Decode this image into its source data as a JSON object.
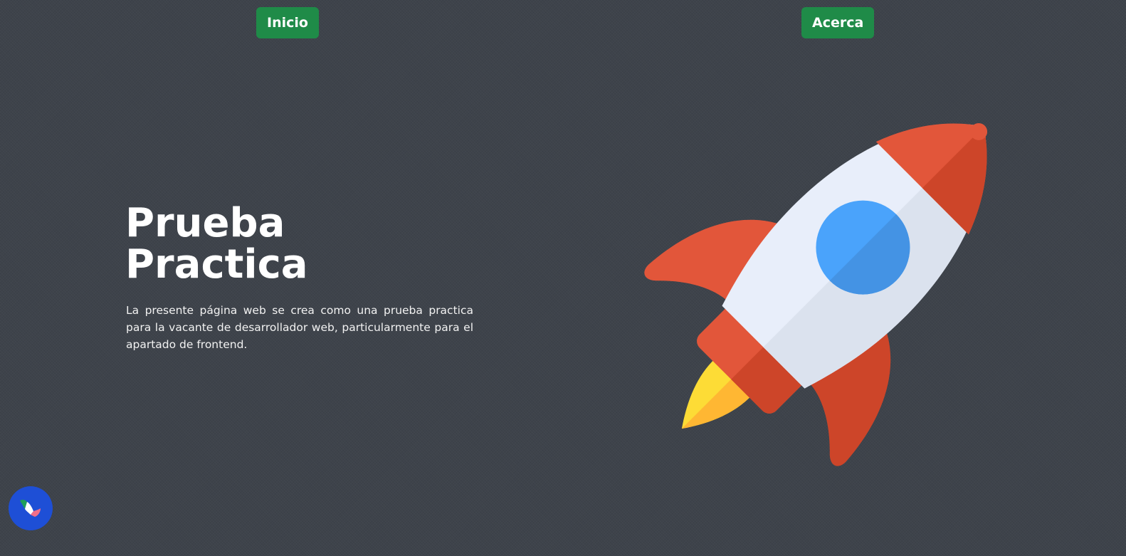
{
  "nav": {
    "inicio_label": "Inicio",
    "acerca_label": "Acerca"
  },
  "hero": {
    "title_line1": "Prueba",
    "title_line2": "Practica",
    "description": "La presente página web se crea como una prueba practica para la vacante de desarrollador web, particularmente para el apartado de frontend."
  },
  "illustration": {
    "icon": "rocket-icon"
  },
  "fab": {
    "icon": "mexico-map-icon"
  },
  "colors": {
    "background": "#3e434b",
    "button": "#1f8b48",
    "fab": "#1e4fd6",
    "rocket_red": "#e2563a",
    "rocket_red_dark": "#cd4529",
    "rocket_body": "#e8eefa",
    "rocket_body_shade": "#dbe2ee",
    "window_blue": "#4aa3fb",
    "window_blue_dark": "#4493e4",
    "flame_yellow": "#fddc36",
    "flame_orange": "#ffb733"
  }
}
